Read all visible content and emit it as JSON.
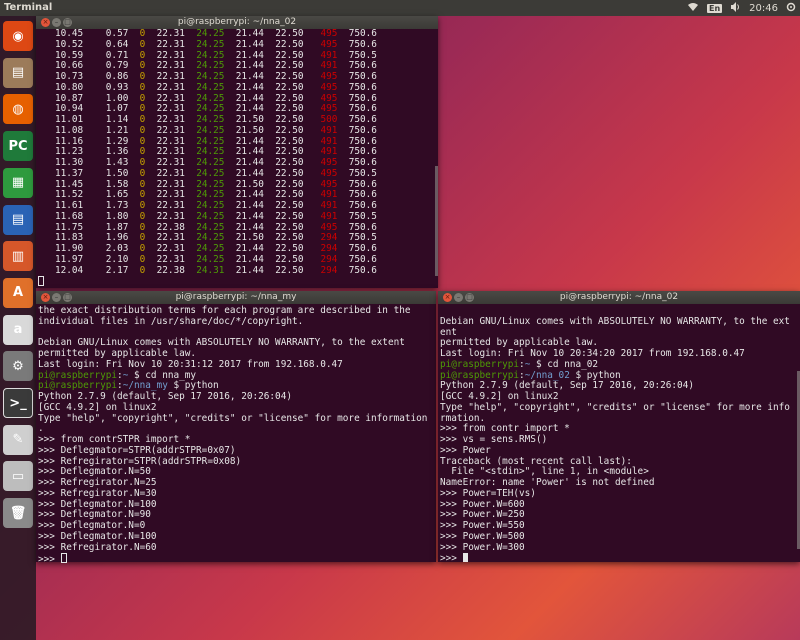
{
  "topbar": {
    "title": "Terminal",
    "lang": "En",
    "time": "20:46"
  },
  "launcher": {
    "items": [
      {
        "name": "dash",
        "glyph": "◉",
        "color": "#dd4814"
      },
      {
        "name": "files",
        "glyph": "▤",
        "color": "#9c7b5a"
      },
      {
        "name": "firefox",
        "glyph": "◍",
        "color": "#e66000"
      },
      {
        "name": "pycharm",
        "glyph": "PC",
        "color": "#1f7a3a"
      },
      {
        "name": "calc",
        "glyph": "▦",
        "color": "#2e9a3e"
      },
      {
        "name": "writer",
        "glyph": "▤",
        "color": "#2a63b5"
      },
      {
        "name": "impress",
        "glyph": "▥",
        "color": "#d6572a"
      },
      {
        "name": "software",
        "glyph": "A",
        "color": "#e0702a"
      },
      {
        "name": "amazon",
        "glyph": "a",
        "color": "#d9d9d9"
      },
      {
        "name": "settings",
        "glyph": "⚙",
        "color": "#7a7a7a"
      },
      {
        "name": "terminal",
        "glyph": ">_",
        "color": "#3a3a3a"
      },
      {
        "name": "editor",
        "glyph": "✎",
        "color": "#cfcfcf"
      },
      {
        "name": "drive",
        "glyph": "▭",
        "color": "#bdbdbd"
      },
      {
        "name": "trash",
        "glyph": "🗑",
        "color": "#8a8a8a"
      }
    ]
  },
  "win1": {
    "title": "pi@raspberrypi: ~/nna_02",
    "rows": [
      [
        "10.45",
        "0.57",
        "0",
        "22.31",
        "24.25",
        "21.44",
        "22.50",
        "495",
        "750.6"
      ],
      [
        "10.52",
        "0.64",
        "0",
        "22.31",
        "24.25",
        "21.44",
        "22.50",
        "495",
        "750.6"
      ],
      [
        "10.59",
        "0.71",
        "0",
        "22.31",
        "24.25",
        "21.44",
        "22.50",
        "491",
        "750.5"
      ],
      [
        "10.66",
        "0.79",
        "0",
        "22.31",
        "24.25",
        "21.44",
        "22.50",
        "491",
        "750.6"
      ],
      [
        "10.73",
        "0.86",
        "0",
        "22.31",
        "24.25",
        "21.44",
        "22.50",
        "495",
        "750.6"
      ],
      [
        "10.80",
        "0.93",
        "0",
        "22.31",
        "24.25",
        "21.44",
        "22.50",
        "495",
        "750.6"
      ],
      [
        "10.87",
        "1.00",
        "0",
        "22.31",
        "24.25",
        "21.44",
        "22.50",
        "495",
        "750.6"
      ],
      [
        "10.94",
        "1.07",
        "0",
        "22.31",
        "24.25",
        "21.44",
        "22.50",
        "495",
        "750.6"
      ],
      [
        "11.01",
        "1.14",
        "0",
        "22.31",
        "24.25",
        "21.50",
        "22.50",
        "500",
        "750.6"
      ],
      [
        "11.08",
        "1.21",
        "0",
        "22.31",
        "24.25",
        "21.50",
        "22.50",
        "491",
        "750.6"
      ],
      [
        "11.16",
        "1.29",
        "0",
        "22.31",
        "24.25",
        "21.44",
        "22.50",
        "491",
        "750.6"
      ],
      [
        "11.23",
        "1.36",
        "0",
        "22.31",
        "24.25",
        "21.44",
        "22.50",
        "491",
        "750.6"
      ],
      [
        "11.30",
        "1.43",
        "0",
        "22.31",
        "24.25",
        "21.44",
        "22.50",
        "495",
        "750.6"
      ],
      [
        "11.37",
        "1.50",
        "0",
        "22.31",
        "24.25",
        "21.44",
        "22.50",
        "495",
        "750.5"
      ],
      [
        "11.45",
        "1.58",
        "0",
        "22.31",
        "24.25",
        "21.50",
        "22.50",
        "495",
        "750.6"
      ],
      [
        "11.52",
        "1.65",
        "0",
        "22.31",
        "24.25",
        "21.44",
        "22.50",
        "491",
        "750.6"
      ],
      [
        "11.61",
        "1.73",
        "0",
        "22.31",
        "24.25",
        "21.44",
        "22.50",
        "491",
        "750.6"
      ],
      [
        "11.68",
        "1.80",
        "0",
        "22.31",
        "24.25",
        "21.44",
        "22.50",
        "491",
        "750.5"
      ],
      [
        "11.75",
        "1.87",
        "0",
        "22.38",
        "24.25",
        "21.44",
        "22.50",
        "495",
        "750.6"
      ],
      [
        "11.83",
        "1.96",
        "0",
        "22.31",
        "24.25",
        "21.50",
        "22.50",
        "294",
        "750.5"
      ],
      [
        "11.90",
        "2.03",
        "0",
        "22.31",
        "24.25",
        "21.44",
        "22.50",
        "294",
        "750.6"
      ],
      [
        "11.97",
        "2.10",
        "0",
        "22.31",
        "24.25",
        "21.44",
        "22.50",
        "294",
        "750.6"
      ],
      [
        "12.04",
        "2.17",
        "0",
        "22.38",
        "24.31",
        "21.44",
        "22.50",
        "294",
        "750.6"
      ]
    ]
  },
  "win2": {
    "title": "pi@raspberrypi: ~/nna_my",
    "lines": [
      {
        "t": "the exact distribution terms for each program are described in the"
      },
      {
        "t": "individual files in /usr/share/doc/*/copyright."
      },
      {
        "t": ""
      },
      {
        "t": "Debian GNU/Linux comes with ABSOLUTELY NO WARRANTY, to the extent"
      },
      {
        "t": "permitted by applicable law."
      },
      {
        "t": "Last login: Fri Nov 10 20:31:12 2017 from 192.168.0.47"
      },
      {
        "user": "pi@raspberrypi",
        "path": "~",
        "cmd": " $ cd nna_my"
      },
      {
        "user": "pi@raspberrypi",
        "path": "~/nna_my",
        "cmd": " $ python"
      },
      {
        "t": "Python 2.7.9 (default, Sep 17 2016, 20:26:04)"
      },
      {
        "t": "[GCC 4.9.2] on linux2"
      },
      {
        "t": "Type \"help\", \"copyright\", \"credits\" or \"license\" for more information"
      },
      {
        "t": "."
      },
      {
        "t": ">>> from contrSTPR import *"
      },
      {
        "t": ">>> Deflegmator=STPR(addrSTPR=0x07)"
      },
      {
        "t": ">>> Refregirator=STPR(addrSTPR=0x08)"
      },
      {
        "t": ">>> Deflegmator.N=50"
      },
      {
        "t": ">>> Refregirator.N=25"
      },
      {
        "t": ">>> Refregirator.N=30"
      },
      {
        "t": ">>> Deflegmator.N=100"
      },
      {
        "t": ">>> Deflegmator.N=90"
      },
      {
        "t": ">>> Deflegmator.N=0"
      },
      {
        "t": ">>> Deflegmator.N=100"
      },
      {
        "t": ">>> Refregirator.N=60"
      },
      {
        "t": ">>> ",
        "cursor": "hollow"
      }
    ]
  },
  "win3": {
    "title": "pi@raspberrypi: ~/nna_02",
    "lines": [
      {
        "t": ""
      },
      {
        "t": "Debian GNU/Linux comes with ABSOLUTELY NO WARRANTY, to the ext"
      },
      {
        "t": "ent"
      },
      {
        "t": "permitted by applicable law."
      },
      {
        "t": "Last login: Fri Nov 10 20:34:20 2017 from 192.168.0.47"
      },
      {
        "user": "pi@raspberrypi",
        "path": "~",
        "cmd": " $ cd nna_02"
      },
      {
        "user": "pi@raspberrypi",
        "path": "~/nna_02",
        "cmd": " $ python"
      },
      {
        "t": "Python 2.7.9 (default, Sep 17 2016, 20:26:04)"
      },
      {
        "t": "[GCC 4.9.2] on linux2"
      },
      {
        "t": "Type \"help\", \"copyright\", \"credits\" or \"license\" for more info"
      },
      {
        "t": "rmation."
      },
      {
        "t": ">>> from contr import *"
      },
      {
        "t": ">>> vs = sens.RMS()"
      },
      {
        "t": ">>> Power"
      },
      {
        "t": "Traceback (most recent call last):"
      },
      {
        "t": "  File \"<stdin>\", line 1, in <module>"
      },
      {
        "t": "NameError: name 'Power' is not defined"
      },
      {
        "t": ">>> Power=TEH(vs)"
      },
      {
        "t": ">>> Power.W=600"
      },
      {
        "t": ">>> Power.W=250"
      },
      {
        "t": ">>> Power.W=550"
      },
      {
        "t": ">>> Power.W=500"
      },
      {
        "t": ">>> Power.W=300"
      },
      {
        "t": ">>> ",
        "cursor": "solid"
      }
    ]
  }
}
